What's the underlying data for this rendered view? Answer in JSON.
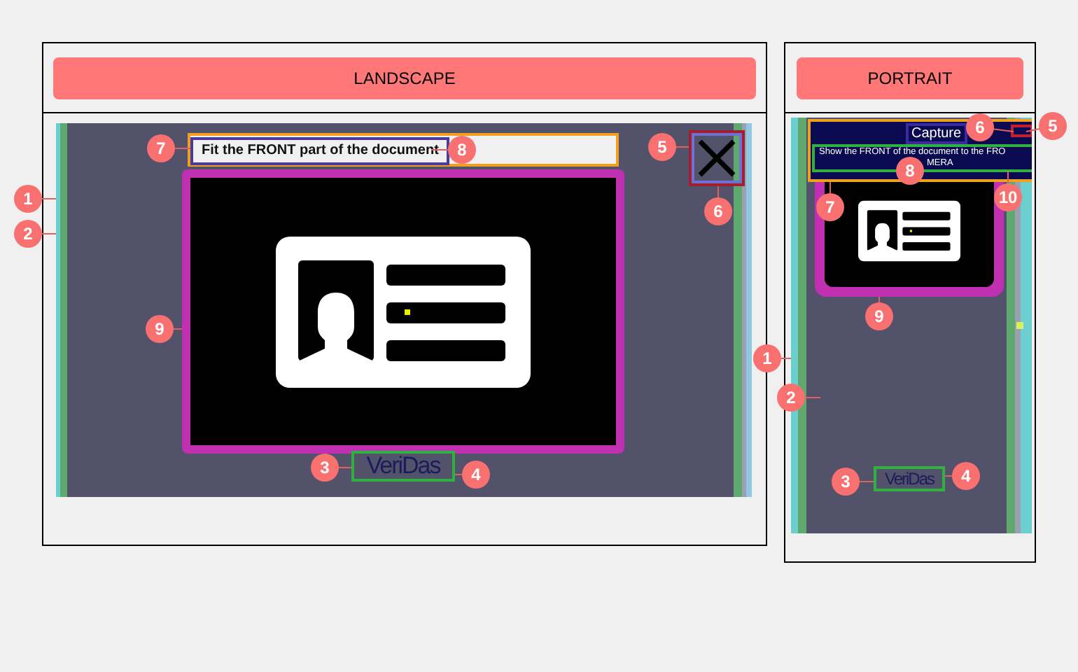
{
  "panels": [
    {
      "kind": "landscape",
      "title": "LANDSCAPE",
      "instruction": "Fit the FRONT part of the document",
      "logo": "VeriDas",
      "markers": [
        "1",
        "2",
        "3",
        "4",
        "5",
        "6",
        "7",
        "8",
        "9"
      ]
    },
    {
      "kind": "portrait",
      "title": "PORTRAIT",
      "header_title": "Capture",
      "caption": [
        "Show the FRONT of the document to the FRO",
        "MERA"
      ],
      "logo": "VeriDas",
      "markers": [
        "1",
        "2",
        "3",
        "4",
        "5",
        "6",
        "7",
        "8",
        "9",
        "10"
      ]
    }
  ]
}
